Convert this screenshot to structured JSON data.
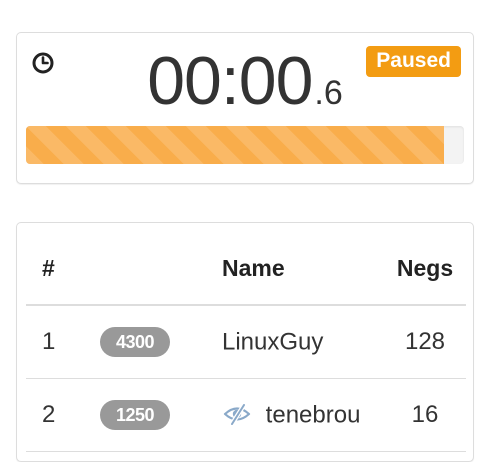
{
  "timer": {
    "main": "00:00",
    "tenths": ".6",
    "status": "Paused",
    "progress_fraction": 0.955
  },
  "scoreboard": {
    "columns": {
      "rank": "#",
      "points": "",
      "name": "Name",
      "negs": "Negs"
    },
    "rows": [
      {
        "rank": "1",
        "points": "4300",
        "name": "LinuxGuy",
        "negs": "128",
        "icon": ""
      },
      {
        "rank": "2",
        "points": "1250",
        "name": "tenebrou",
        "negs": "16",
        "icon": "eye-slash-icon"
      }
    ]
  },
  "colors": {
    "badge_orange": "#f39c12",
    "progress_orange": "#f9ad4b",
    "points_gray": "#999999",
    "icon_blue": "#8aa9c9"
  }
}
